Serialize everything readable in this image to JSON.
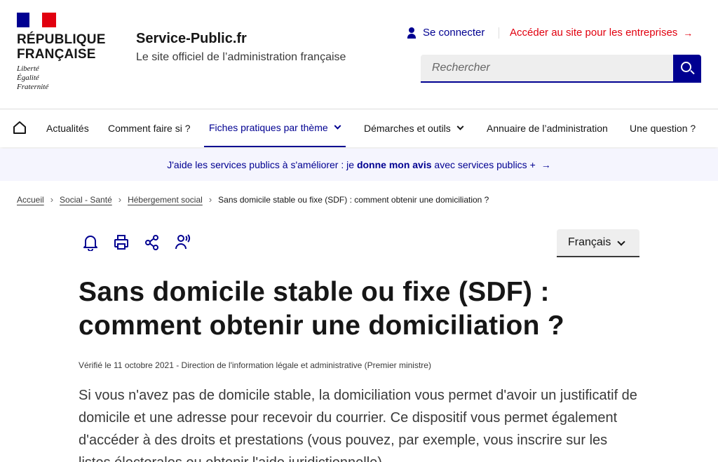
{
  "header": {
    "republic_line1": "RÉPUBLIQUE",
    "republic_line2": "FRANÇAISE",
    "devise": [
      "Liberté",
      "Égalité",
      "Fraternité"
    ],
    "service_title": "Service-Public.fr",
    "service_tagline": "Le site officiel de l’administration française",
    "login_label": "Se connecter",
    "pro_link_label": "Accéder au site pour les entreprises",
    "pro_link_arrow": "→",
    "search_placeholder": "Rechercher"
  },
  "nav": {
    "items": [
      {
        "label": "Actualités"
      },
      {
        "label": "Comment faire si ?"
      },
      {
        "label": "Fiches pratiques par thème",
        "active": true
      },
      {
        "label": "Démarches et outils"
      },
      {
        "label": "Annuaire de l’administration"
      },
      {
        "label": "Une question ?"
      }
    ]
  },
  "banner": {
    "prefix": "J'aide les services publics à s'améliorer : je",
    "bold": "donne mon avis",
    "suffix": "avec services publics +",
    "arrow": "→"
  },
  "breadcrumb": {
    "items": [
      "Accueil",
      "Social - Santé",
      "Hébergement social"
    ],
    "current": "Sans domicile stable ou fixe (SDF) : comment obtenir une domiciliation ?",
    "separator": "›"
  },
  "actions": {
    "icons": [
      "bell-icon",
      "printer-icon",
      "share-icon",
      "text-to-speech-icon"
    ]
  },
  "language": {
    "selected": "Français"
  },
  "content": {
    "title_line1": "Sans domicile stable ou fixe (SDF) :",
    "title_line2": "comment obtenir une domiciliation ?",
    "verified": "Vérifié le 11 octobre 2021 - Direction de l'information légale et administrative (Premier ministre)",
    "lead": "Si vous n'avez pas de domicile stable, la domiciliation vous permet d'avoir un justificatif de domicile et une adresse pour recevoir du courrier. Ce dispositif vous permet également d'accéder à des droits et prestations (vous pouvez, par exemple, vous inscrire sur les listes électorales ou obtenir l'aide juridictionnelle)."
  },
  "colors": {
    "primary": "#000091",
    "accent_red": "#e1000f",
    "banner_bg": "#f5f5fe"
  }
}
